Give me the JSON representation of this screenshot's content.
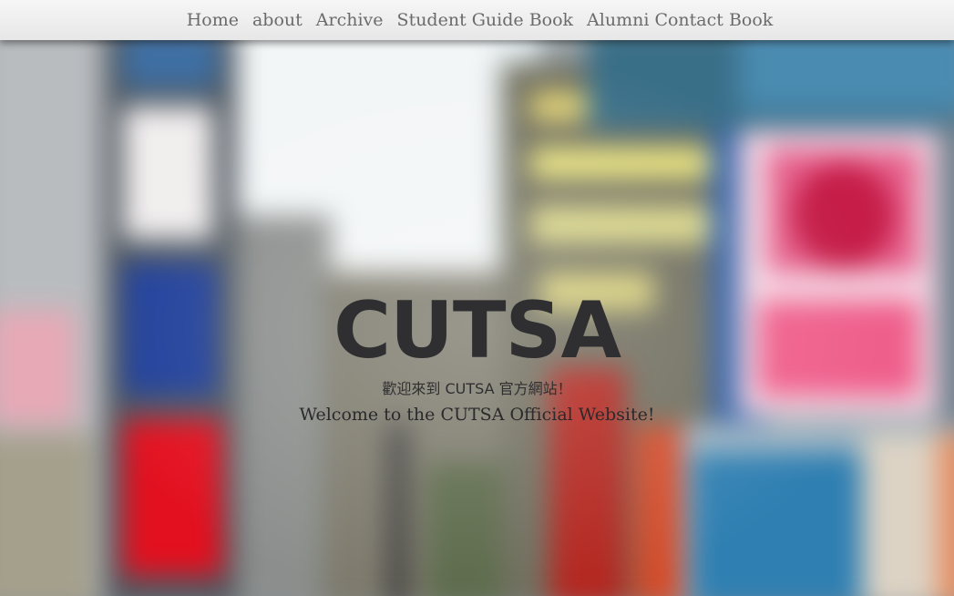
{
  "nav": {
    "items": [
      {
        "label": "Home"
      },
      {
        "label": "about"
      },
      {
        "label": "Archive"
      },
      {
        "label": "Student Guide Book"
      },
      {
        "label": "Alumni Contact Book"
      }
    ]
  },
  "hero": {
    "title": "CUTSA",
    "subtitle_zh": "歡迎來到 CUTSA 官方網站！",
    "subtitle_en": "Welcome to the CUTSA Official Website!"
  },
  "background": {
    "description_icon": "blurred-city-photo",
    "accent_colors": [
      "#d8e6ee",
      "#1f3f8f",
      "#e3101f",
      "#f4f0b0",
      "#2c6fa3",
      "#e94a7c"
    ]
  }
}
